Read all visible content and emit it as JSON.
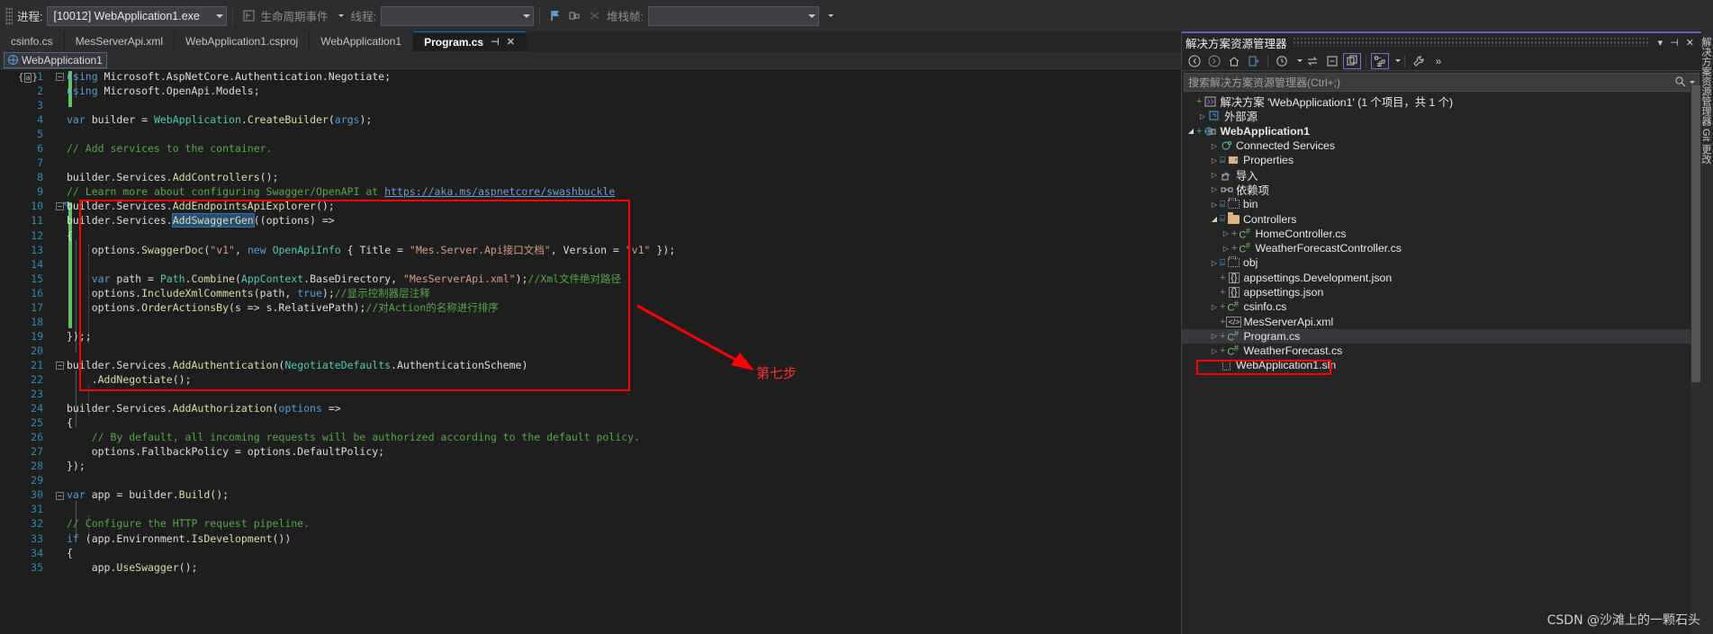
{
  "toolbar": {
    "process_label": "进程:",
    "process_value": "[10012] WebApplication1.exe",
    "lifecycle_label": "生命周期事件",
    "thread_label": "线程:",
    "thread_value": "",
    "stackframe_label": "堆栈帧:",
    "stackframe_value": ""
  },
  "tabs": [
    {
      "label": "csinfo.cs",
      "active": false
    },
    {
      "label": "MesServerApi.xml",
      "active": false
    },
    {
      "label": "WebApplication1.csproj",
      "active": false
    },
    {
      "label": "WebApplication1",
      "active": false
    },
    {
      "label": "Program.cs",
      "active": true,
      "pin": "⊣",
      "close": "✕"
    }
  ],
  "navbar": {
    "project": "WebApplication1"
  },
  "annotation": {
    "step_text": "第七步",
    "box_color": "#ff0000",
    "text_color": "#ff2d2d"
  },
  "code": {
    "lines": [
      {
        "n": "1",
        "html": "<span class=\"kw\">using</span> Microsoft.AspNetCore.Authentication.Negotiate;"
      },
      {
        "n": "2",
        "html": "<span class=\"kw\">using</span> Microsoft.OpenApi.Models;"
      },
      {
        "n": "3",
        "html": ""
      },
      {
        "n": "4",
        "html": "<span class=\"kw\">var</span> builder = <span class=\"typ\">WebApplication</span>.<span class=\"mth\">CreateBuilder</span>(<span class=\"kw\">args</span>);"
      },
      {
        "n": "5",
        "html": ""
      },
      {
        "n": "6",
        "html": "<span class=\"cmt\">// Add services to the container.</span>"
      },
      {
        "n": "7",
        "html": ""
      },
      {
        "n": "8",
        "html": "builder.Services.<span class=\"mth\">AddControllers</span>();"
      },
      {
        "n": "9",
        "html": "<span class=\"cmt\">// Learn more about configuring Swagger/OpenAPI at </span><span class=\"lnk\">https://aka.ms/aspnetcore/swashbuckle</span>"
      },
      {
        "n": "10",
        "html": "builder.Services.<span class=\"mth\">AddEndpointsApiExplorer</span>();"
      },
      {
        "n": "11",
        "html": "builder.Services.<span class=\"mth sel\">AddSwaggerGen</span>((options) =&gt;"
      },
      {
        "n": "12",
        "html": "{"
      },
      {
        "n": "13",
        "html": "    options.<span class=\"mth\">SwaggerDoc</span>(<span class=\"str\">\"v1\"</span>, <span class=\"kw\">new</span> <span class=\"typ\">OpenApiInfo</span> { Title = <span class=\"str\">\"Mes.Server.Api接口文档\"</span>, Version = <span class=\"str\">\"v1\"</span> });"
      },
      {
        "n": "14",
        "html": ""
      },
      {
        "n": "15",
        "html": "    <span class=\"kw\">var</span> path = <span class=\"typ\">Path</span>.<span class=\"mth\">Combine</span>(<span class=\"typ\">AppContext</span>.BaseDirectory, <span class=\"str\">\"MesServerApi.xml\"</span>);<span class=\"cmt\">//Xml文件绝对路径</span>"
      },
      {
        "n": "16",
        "html": "    options.<span class=\"mth\">IncludeXmlComments</span>(path, <span class=\"kw\">true</span>);<span class=\"cmt\">//显示控制器层注释</span>"
      },
      {
        "n": "17",
        "html": "    options.<span class=\"mth\">OrderActionsBy</span>(s =&gt; s.RelativePath);<span class=\"cmt\">//对Action的名称进行排序</span>"
      },
      {
        "n": "18",
        "html": ""
      },
      {
        "n": "19",
        "html": "});;"
      },
      {
        "n": "20",
        "html": ""
      },
      {
        "n": "21",
        "html": "builder.Services.<span class=\"mth\">AddAuthentication</span>(<span class=\"typ\">NegotiateDefaults</span>.AuthenticationScheme)"
      },
      {
        "n": "22",
        "html": "    .<span class=\"mth\">AddNegotiate</span>();"
      },
      {
        "n": "23",
        "html": ""
      },
      {
        "n": "24",
        "html": "builder.Services.<span class=\"mth\">AddAuthorization</span>(<span class=\"kw\">options</span> =&gt;"
      },
      {
        "n": "25",
        "html": "{"
      },
      {
        "n": "26",
        "html": "    <span class=\"cmt\">// By default, all incoming requests will be authorized according to the default policy.</span>"
      },
      {
        "n": "27",
        "html": "    options.FallbackPolicy = options.DefaultPolicy;"
      },
      {
        "n": "28",
        "html": "});"
      },
      {
        "n": "29",
        "html": ""
      },
      {
        "n": "30",
        "html": "<span class=\"kw\">var</span> app = builder.<span class=\"mth\">Build</span>();"
      },
      {
        "n": "31",
        "html": ""
      },
      {
        "n": "32",
        "html": "<span class=\"cmt\">// Configure the HTTP request pipeline.</span>"
      },
      {
        "n": "33",
        "html": "<span class=\"kw\">if</span> (app.Environment.<span class=\"mth\">IsDevelopment</span>())"
      },
      {
        "n": "34",
        "html": "{"
      },
      {
        "n": "35",
        "html": "    app.<span class=\"mth\">UseSwagger</span>();"
      }
    ]
  },
  "solution_explorer": {
    "title": "解决方案资源管理器",
    "header_buttons": {
      "menu": "▾",
      "dock": "⊣",
      "close": "✕"
    },
    "toolbar_icons": [
      "back-arrow",
      "forward-arrow",
      "home",
      "sync-with-active-document",
      "pending-changes",
      "collapse-all",
      "show-all-files",
      "properties-view",
      "wrench",
      "overflow"
    ],
    "search_placeholder": "搜索解决方案资源管理器(Ctrl+;)",
    "tree": [
      {
        "indent": 0,
        "tw": "",
        "plus": true,
        "lock": false,
        "icon": "solution",
        "label": "解决方案 'WebApplication1' (1 个项目，共 1 个)",
        "bold": false,
        "selected": false
      },
      {
        "indent": 1,
        "tw": "▷",
        "plus": false,
        "lock": false,
        "icon": "external",
        "label": "外部源",
        "bold": false,
        "selected": false
      },
      {
        "indent": 0,
        "tw": "◢",
        "plus": true,
        "lock": false,
        "icon": "project",
        "label": "WebApplication1",
        "bold": true,
        "selected": false
      },
      {
        "indent": 2,
        "tw": "▷",
        "plus": false,
        "lock": false,
        "icon": "connected",
        "label": "Connected Services",
        "bold": false,
        "selected": false
      },
      {
        "indent": 2,
        "tw": "▷",
        "plus": false,
        "lock": true,
        "icon": "props",
        "label": "Properties",
        "bold": false,
        "selected": false
      },
      {
        "indent": 2,
        "tw": "▷",
        "plus": false,
        "lock": false,
        "icon": "import",
        "label": "导入",
        "bold": false,
        "selected": false
      },
      {
        "indent": 2,
        "tw": "▷",
        "plus": false,
        "lock": false,
        "icon": "deps",
        "label": "依赖项",
        "bold": false,
        "selected": false
      },
      {
        "indent": 2,
        "tw": "▷",
        "plus": false,
        "lock": true,
        "icon": "folder-dim",
        "label": "bin",
        "bold": false,
        "selected": false
      },
      {
        "indent": 2,
        "tw": "◢",
        "plus": false,
        "lock": true,
        "icon": "folder",
        "label": "Controllers",
        "bold": false,
        "selected": false
      },
      {
        "indent": 3,
        "tw": "▷",
        "plus": true,
        "lock": false,
        "icon": "cs",
        "label": "HomeController.cs",
        "bold": false,
        "selected": false
      },
      {
        "indent": 3,
        "tw": "▷",
        "plus": true,
        "lock": false,
        "icon": "cs",
        "label": "WeatherForecastController.cs",
        "bold": false,
        "selected": false
      },
      {
        "indent": 2,
        "tw": "▷",
        "plus": false,
        "lock": true,
        "icon": "folder-dim",
        "label": "obj",
        "bold": false,
        "selected": false
      },
      {
        "indent": 2,
        "tw": "",
        "plus": true,
        "lock": false,
        "icon": "json",
        "label": "appsettings.Development.json",
        "bold": false,
        "selected": false
      },
      {
        "indent": 2,
        "tw": "",
        "plus": true,
        "lock": false,
        "icon": "json",
        "label": "appsettings.json",
        "bold": false,
        "selected": false
      },
      {
        "indent": 2,
        "tw": "▷",
        "plus": true,
        "lock": false,
        "icon": "cs",
        "label": "csinfo.cs",
        "bold": false,
        "selected": false
      },
      {
        "indent": 2,
        "tw": "",
        "plus": true,
        "lock": false,
        "icon": "xml",
        "label": "MesServerApi.xml",
        "bold": false,
        "selected": false
      },
      {
        "indent": 2,
        "tw": "▷",
        "plus": true,
        "lock": false,
        "icon": "cs",
        "label": "Program.cs",
        "bold": false,
        "selected": true
      },
      {
        "indent": 2,
        "tw": "▷",
        "plus": true,
        "lock": false,
        "icon": "cs",
        "label": "WeatherForecast.cs",
        "bold": false,
        "selected": false
      },
      {
        "indent": 2,
        "tw": "",
        "plus": false,
        "lock": false,
        "icon": "file",
        "label": "WebApplication1.sln",
        "bold": false,
        "selected": false
      }
    ]
  },
  "side_strip_label": "解决方案资源管理器    Git 更改",
  "watermark": "CSDN @沙滩上的一颗石头"
}
